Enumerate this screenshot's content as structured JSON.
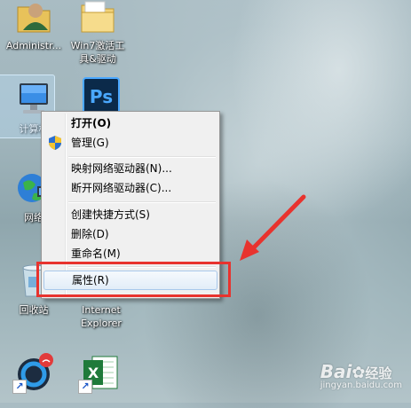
{
  "desktop": {
    "icons": [
      {
        "label": "Administr...",
        "icon": "user-folder-icon"
      },
      {
        "label": "Win7激活工\n具&驱动",
        "icon": "folder-icon"
      },
      {
        "label": "计算机",
        "icon": "computer-icon",
        "selected": true
      },
      {
        "label": "Ps",
        "icon": "photoshop-icon"
      },
      {
        "label": "网络",
        "icon": "network-icon"
      },
      {
        "label": "回收站",
        "icon": "recycle-bin-icon"
      },
      {
        "label": "Internet\nExplorer",
        "icon": "internet-explorer-icon"
      },
      {
        "label": "",
        "icon": "app-shortcut-icon"
      },
      {
        "label": "",
        "icon": "excel-icon"
      }
    ]
  },
  "context_menu": {
    "items": [
      {
        "label": "打开(O)",
        "bold": true
      },
      {
        "label": "管理(G)",
        "icon": "uac-shield-icon"
      },
      {
        "label": "映射网络驱动器(N)..."
      },
      {
        "label": "断开网络驱动器(C)..."
      },
      {
        "label": "创建快捷方式(S)"
      },
      {
        "label": "删除(D)"
      },
      {
        "label": "重命名(M)"
      },
      {
        "label": "属性(R)",
        "highlighted": true
      }
    ]
  },
  "annotation": {
    "box_color": "#e8332e",
    "arrow_color": "#e8332e"
  },
  "watermark": {
    "brand": "Bai",
    "brand2": "经验",
    "url": "jingyan.baidu.com"
  }
}
